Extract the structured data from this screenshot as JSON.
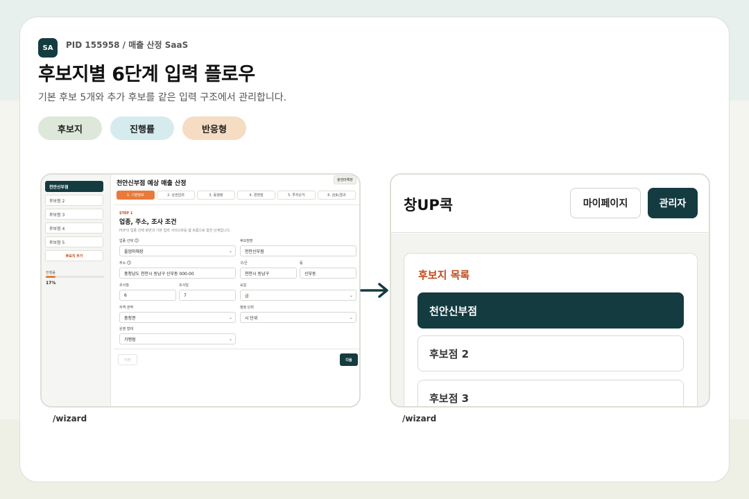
{
  "header": {
    "logo_badge": "SA",
    "pid": "PID 155958 / 매출 산정 SaaS",
    "title": "후보지별 6단계 입력 플로우",
    "subtitle": "기본 후보 5개와 추가 후보를 같은 입력 구조에서 관리합니다."
  },
  "chips": [
    "후보지",
    "진행률",
    "반응형"
  ],
  "left_shot": {
    "path": "/wizard",
    "sidebar": {
      "items": [
        "천안신부점",
        "후보점 2",
        "후보점 3",
        "후보점 4",
        "후보점 5"
      ],
      "add_label": "후보지 추가",
      "progress_label": "진행률",
      "progress_value": "17%",
      "progress_fraction": 0.17
    },
    "page_title": "천안신부점 예상 매출 산정",
    "tag": "올엄마해장",
    "steps": [
      "1. 기본정보",
      "2. 상권입력",
      "3. 동행량",
      "4. 경쟁점",
      "5. 투자손익",
      "6. 검토/결과"
    ],
    "step_label": "STEP 1",
    "section_title": "업종, 주소, 조사 조건",
    "section_desc": "PDF의 업종 선택 화면과 기본 입력 서이드바를 웹 흐름으로 합친 단계입니다.",
    "fields": {
      "industry_label": "업종 선택",
      "industry_value": "올엄마해장",
      "store_name_label": "후보점명",
      "store_name_value": "천안신부점",
      "address_label": "주소",
      "address_value": "충청남도 천안시 동남구 신부동 000-00",
      "district_label": "구/군",
      "district_value": "천안시 동남구",
      "dong_label": "동",
      "dong_value": "신부동",
      "month_label": "조사월",
      "month_value": "6",
      "day_label": "조사일",
      "day_value": "7",
      "weekday_label": "요일",
      "weekday_value": "금",
      "region_label": "지역 권역",
      "region_value": "충청권",
      "admin_unit_label": "행정 단위",
      "admin_unit_value": "시 단위",
      "operation_label": "운영 형태",
      "operation_value": "가맹점"
    },
    "prev_label": "이전",
    "next_label": "다음"
  },
  "right_shot": {
    "path": "/wizard",
    "logo": "창UP콕",
    "mypage_label": "마이페이지",
    "admin_label": "관리자",
    "list_title": "후보지 목록",
    "items": [
      "천안신부점",
      "후보점 2",
      "후보점 3"
    ]
  },
  "colors": {
    "primary": "#143b40",
    "accent": "#e87a3c",
    "accent_text": "#c04a1a"
  },
  "icons": [
    "arrow-right-icon",
    "chevron-down-icon",
    "help-icon"
  ]
}
